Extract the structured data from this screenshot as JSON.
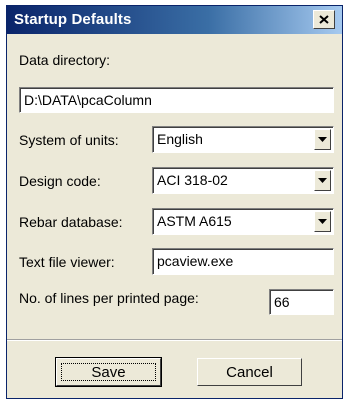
{
  "window": {
    "title": "Startup Defaults",
    "close_glyph": "✕"
  },
  "fields": {
    "data_directory": {
      "label": "Data directory:",
      "value": "D:\\DATA\\pcaColumn"
    },
    "system_of_units": {
      "label": "System of units:",
      "value": "English"
    },
    "design_code": {
      "label": "Design code:",
      "value": "ACI 318-02"
    },
    "rebar_database": {
      "label": "Rebar database:",
      "value": "ASTM A615"
    },
    "text_file_viewer": {
      "label": "Text file viewer:",
      "value": "pcaview.exe"
    },
    "lines_per_page": {
      "label": "No. of lines per printed page:",
      "value": "66"
    }
  },
  "buttons": {
    "save": "Save",
    "cancel": "Cancel"
  },
  "colors": {
    "title_start": "#0a246a",
    "title_end": "#a6caf0",
    "face": "#ece9d8"
  }
}
